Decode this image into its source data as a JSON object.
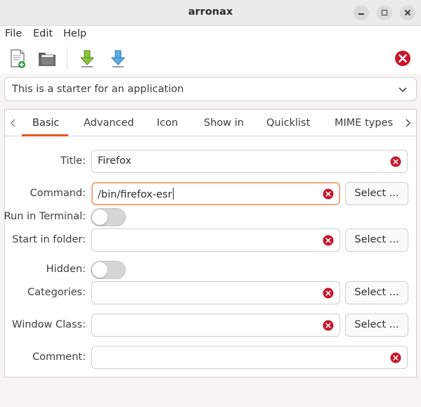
{
  "window": {
    "title": "arronax"
  },
  "menu": {
    "file": "File",
    "edit": "Edit",
    "help": "Help"
  },
  "toolbar": {
    "icons": [
      "new-document-icon",
      "open-folder-icon",
      "download-green-icon",
      "download-blue-icon",
      "error-close-icon"
    ]
  },
  "template_combo": {
    "value": "This is a starter for an application"
  },
  "tabs": [
    {
      "label": "Basic",
      "active": true
    },
    {
      "label": "Advanced"
    },
    {
      "label": "Icon"
    },
    {
      "label": "Show in"
    },
    {
      "label": "Quicklist"
    },
    {
      "label": "MIME types"
    }
  ],
  "form": {
    "title_label": "Title:",
    "title_value": "Firefox",
    "command_label": "Command:",
    "command_value": "/bin/firefox-esr",
    "run_in_terminal_label": "Run in Terminal:",
    "run_in_terminal_on": false,
    "start_in_folder_label": "Start in folder:",
    "start_in_folder_value": "",
    "hidden_label": "Hidden:",
    "hidden_on": false,
    "categories_label": "Categories:",
    "categories_value": "",
    "window_class_label": "Window Class:",
    "window_class_value": "",
    "comment_label": "Comment:",
    "comment_value": "",
    "select_label": "Select ..."
  },
  "colors": {
    "accent": "#e95420",
    "clear_red": "#c7162b",
    "focus_border": "#f0a883"
  }
}
